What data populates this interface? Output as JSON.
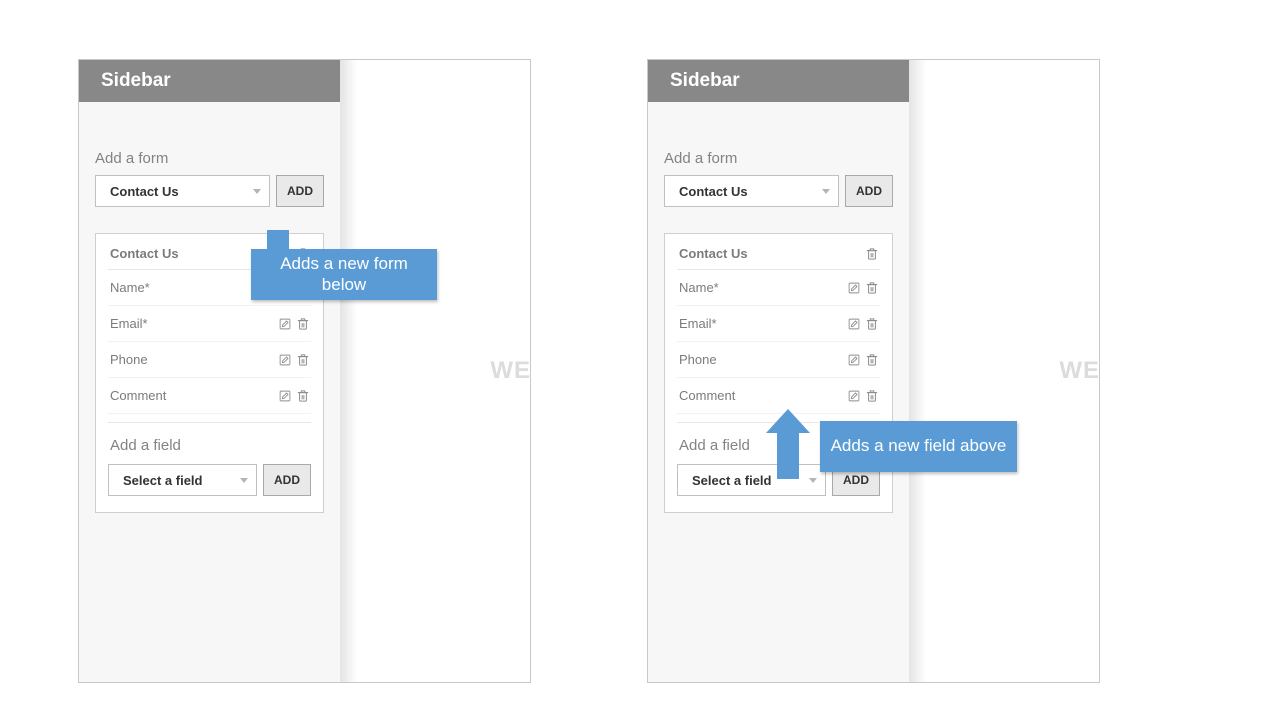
{
  "sidebar_title": "Sidebar",
  "add_form_label": "Add a form",
  "form_select_value": "Contact Us",
  "add_button_label": "ADD",
  "card": {
    "title": "Contact Us",
    "fields": [
      "Name*",
      "Email*",
      "Phone",
      "Comment"
    ]
  },
  "add_field_label": "Add a field",
  "field_select_value": "Select a field",
  "canvas_watermark": "WE",
  "callouts": {
    "add_form": "Adds a new form below",
    "add_field": "Adds a new field above"
  },
  "icons": {
    "edit": "edit-icon",
    "trash": "trash-icon",
    "chevron_down": "chevron-down-icon"
  },
  "colors": {
    "header_bg": "#888888",
    "accent": "#5b9bd5",
    "button_bg": "#e9e9e9",
    "text_muted": "#7b7b7b"
  }
}
